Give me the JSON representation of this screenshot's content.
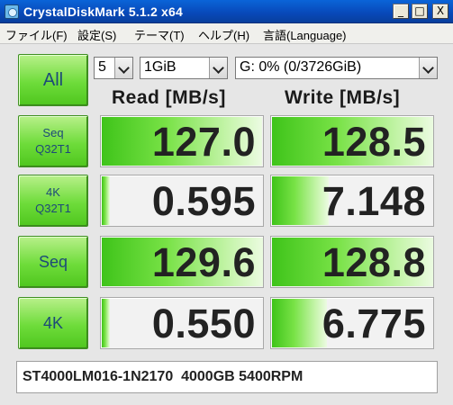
{
  "window": {
    "title": "CrystalDiskMark 5.1.2  x64",
    "controls": {
      "minimize": "_",
      "maximize": "□",
      "close": "X"
    }
  },
  "menu": [
    {
      "label": "ファイル(F)"
    },
    {
      "label": "設定(S)"
    },
    {
      "label": "テーマ(T)"
    },
    {
      "label": "ヘルプ(H)"
    },
    {
      "label": "言語(Language)"
    }
  ],
  "controls": {
    "all_label": "All",
    "count": "5",
    "size": "1GiB",
    "drive": "G: 0% (0/3726GiB)"
  },
  "headers": {
    "read": "Read [MB/s]",
    "write": "Write [MB/s]"
  },
  "tests": [
    {
      "line1": "Seq",
      "line2": "Q32T1",
      "read": "127.0",
      "write": "128.5",
      "read_fill": 0.99,
      "write_fill": 1.0
    },
    {
      "line1": "4K",
      "line2": "Q32T1",
      "read": "0.595",
      "write": "7.148",
      "read_fill": 0.05,
      "write_fill": 0.35
    },
    {
      "line1": "Seq",
      "line2": "",
      "read": "129.6",
      "write": "128.8",
      "read_fill": 1.0,
      "write_fill": 1.0
    },
    {
      "line1": "4K",
      "line2": "",
      "read": "0.550",
      "write": "6.775",
      "read_fill": 0.05,
      "write_fill": 0.34
    }
  ],
  "drive_info": "ST4000LM016-1N2170  4000GB 5400RPM",
  "colors": {
    "title_bar": "#0a5cd0",
    "button_green": "#6edc3a",
    "bar_green": "#56d020",
    "label_blue": "#1d4a78"
  }
}
